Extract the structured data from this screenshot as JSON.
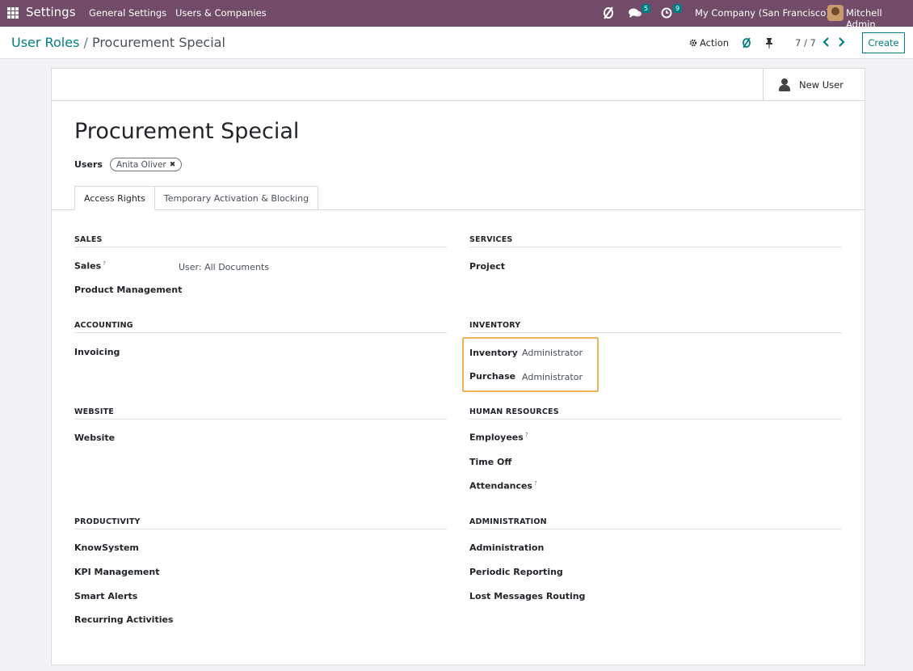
{
  "navbar": {
    "brand": "Settings",
    "menus": [
      "General Settings",
      "Users & Companies"
    ],
    "messages_badge": "5",
    "activities_badge": "9",
    "company": "My Company (San Francisco)",
    "user": "Mitchell Admin",
    "accent_color": "#714b67"
  },
  "breadcrumb": {
    "parent": "User Roles",
    "separator": "/",
    "current": "Procurement Special"
  },
  "control": {
    "action_label": "Action",
    "pager": "7 / 7",
    "create_label": "Create"
  },
  "form": {
    "stat_button_label": "New User",
    "title": "Procurement Special",
    "users_label": "Users",
    "user_tags": [
      "Anita Oliver"
    ],
    "tabs": [
      "Access Rights",
      "Temporary Activation & Blocking"
    ],
    "active_tab": "Access Rights"
  },
  "groups": {
    "sales": {
      "title": "SALES",
      "fields": [
        {
          "label": "Sales",
          "help": "?",
          "value": "User: All Documents"
        },
        {
          "label": "Product Management",
          "value": ""
        }
      ]
    },
    "services": {
      "title": "SERVICES",
      "fields": [
        {
          "label": "Project",
          "value": ""
        }
      ]
    },
    "accounting": {
      "title": "ACCOUNTING",
      "fields": [
        {
          "label": "Invoicing",
          "value": ""
        }
      ]
    },
    "inventory": {
      "title": "INVENTORY",
      "fields": [
        {
          "label": "Inventory",
          "value": "Administrator"
        },
        {
          "label": "Purchase",
          "value": "Administrator"
        }
      ]
    },
    "website": {
      "title": "WEBSITE",
      "fields": [
        {
          "label": "Website",
          "value": ""
        }
      ]
    },
    "human_resources": {
      "title": "HUMAN RESOURCES",
      "fields": [
        {
          "label": "Employees",
          "help": "?",
          "value": ""
        },
        {
          "label": "Time Off",
          "value": ""
        },
        {
          "label": "Attendances",
          "help": "?",
          "value": ""
        }
      ]
    },
    "productivity": {
      "title": "PRODUCTIVITY",
      "fields": [
        {
          "label": "KnowSystem",
          "value": ""
        },
        {
          "label": "KPI Management",
          "value": ""
        },
        {
          "label": "Smart Alerts",
          "value": ""
        },
        {
          "label": "Recurring Activities",
          "value": ""
        }
      ]
    },
    "administration": {
      "title": "ADMINISTRATION",
      "fields": [
        {
          "label": "Administration",
          "value": ""
        },
        {
          "label": "Periodic Reporting",
          "value": ""
        },
        {
          "label": "Lost Messages Routing",
          "value": ""
        }
      ]
    }
  }
}
